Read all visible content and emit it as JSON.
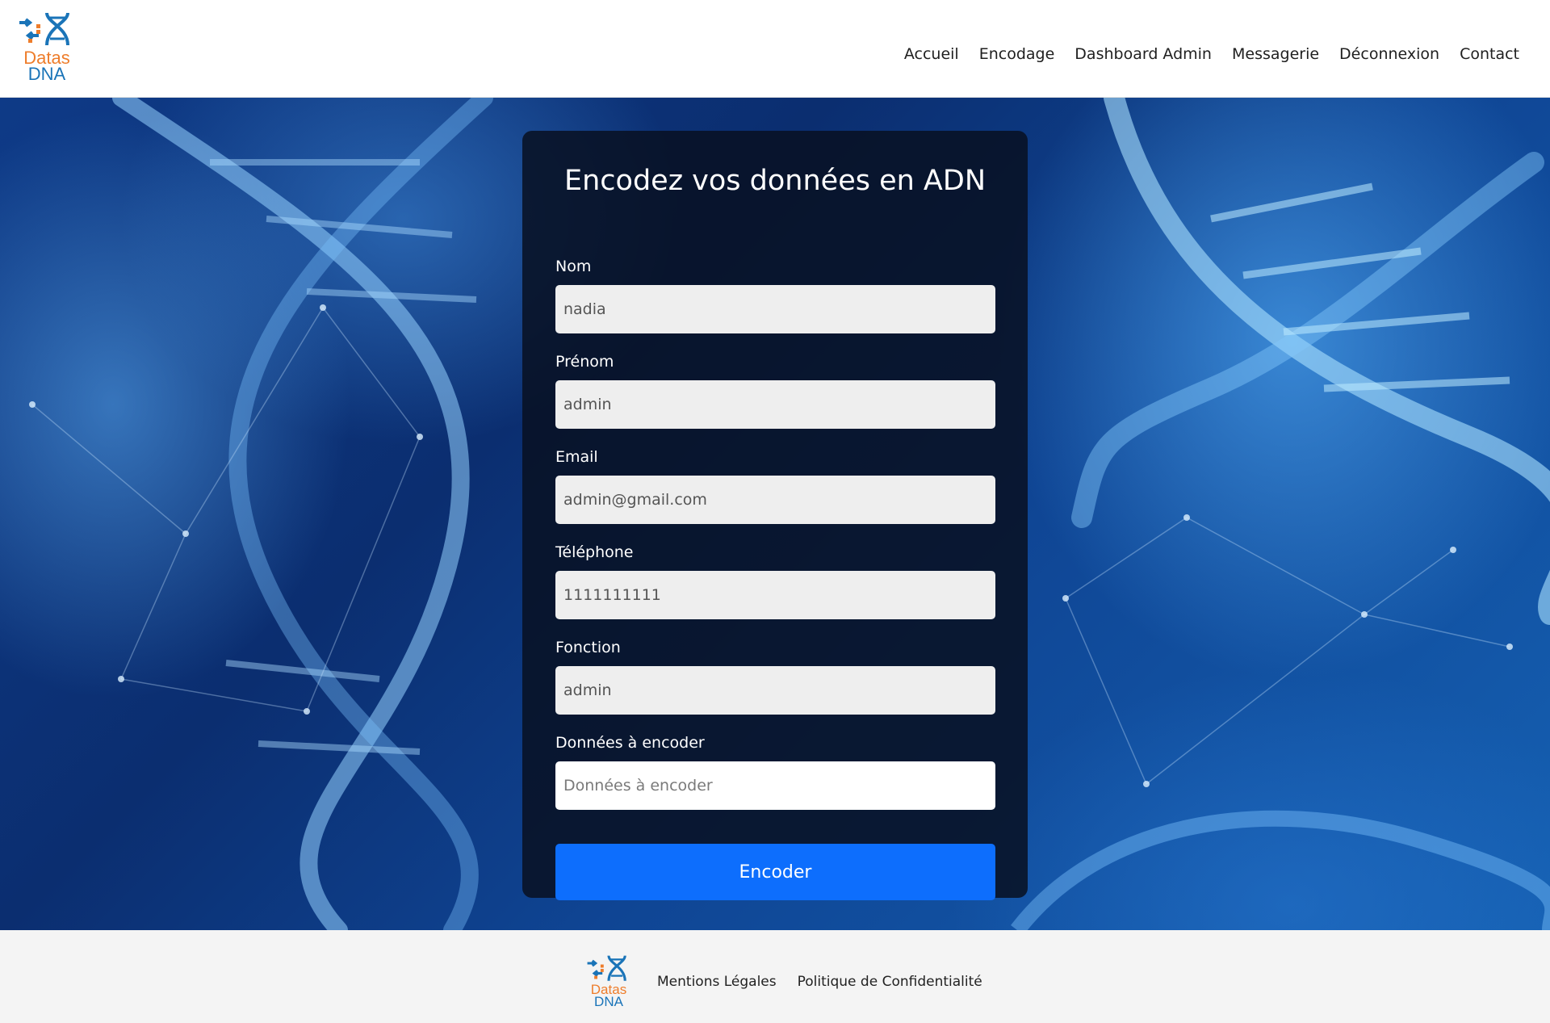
{
  "brand": {
    "line1": "Datas",
    "line2": "DNA",
    "orange": "#ee7d2b",
    "blue": "#1a74b8"
  },
  "nav": {
    "items": [
      "Accueil",
      "Encodage",
      "Dashboard Admin",
      "Messagerie",
      "Déconnexion",
      "Contact"
    ]
  },
  "form": {
    "title": "Encodez vos données en ADN",
    "fields": [
      {
        "label": "Nom",
        "value": "nadia"
      },
      {
        "label": "Prénom",
        "value": "admin"
      },
      {
        "label": "Email",
        "value": "admin@gmail.com"
      },
      {
        "label": "Téléphone",
        "value": "1111111111"
      },
      {
        "label": "Fonction",
        "value": "admin"
      },
      {
        "label": "Données à encoder",
        "value": "",
        "placeholder": "Données à encoder"
      }
    ],
    "submit_label": "Encoder",
    "accent": "#0d6efd"
  },
  "footer": {
    "links": [
      "Mentions Légales",
      "Politique de Confidentialité"
    ]
  }
}
